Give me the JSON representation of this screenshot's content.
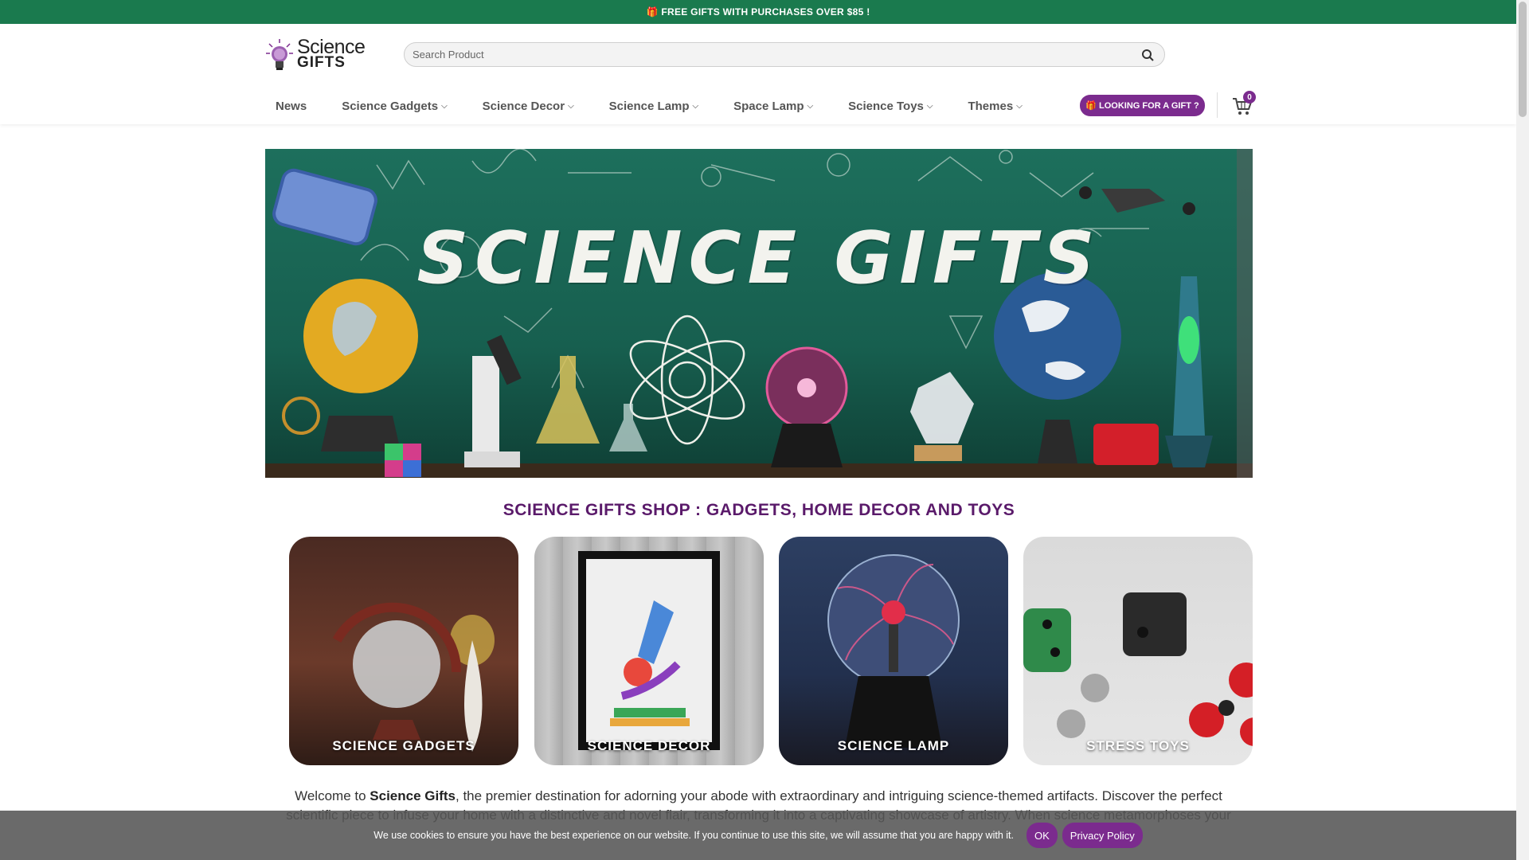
{
  "topbar": {
    "text": "🎁 FREE GIFTS WITH PURCHASES OVER $85 !"
  },
  "logo": {
    "line1": "Science",
    "line2": "GIFTS"
  },
  "search": {
    "placeholder": "Search Product"
  },
  "nav": {
    "items": [
      {
        "label": "News",
        "has_dropdown": false
      },
      {
        "label": "Science Gadgets",
        "has_dropdown": true
      },
      {
        "label": "Science Decor",
        "has_dropdown": true
      },
      {
        "label": "Science Lamp",
        "has_dropdown": true
      },
      {
        "label": "Space Lamp",
        "has_dropdown": true
      },
      {
        "label": "Science Toys",
        "has_dropdown": true
      },
      {
        "label": "Themes",
        "has_dropdown": true
      }
    ],
    "gift_button": "🎁 LOOKING FOR A GIFT ?",
    "cart_count": "0"
  },
  "hero": {
    "title": "SCIENCE GIFTS"
  },
  "section": {
    "title": "SCIENCE GIFTS SHOP : GADGETS, HOME DECOR AND TOYS"
  },
  "categories": [
    {
      "label": "SCIENCE GADGETS"
    },
    {
      "label": "SCIENCE DECOR"
    },
    {
      "label": "SCIENCE LAMP"
    },
    {
      "label": "STRESS TOYS"
    }
  ],
  "intro": {
    "prefix": "Welcome to ",
    "brand": "Science Gifts",
    "text": ", the premier destination for adorning your abode with extraordinary and intriguing science-themed artifacts. Discover the perfect scientific piece to infuse your home with a distinctive and novel flair, transforming it into a captivating showcase of artistry. When science metamorphoses your"
  },
  "cookie": {
    "text": "We use cookies to ensure you have the best experience on our website. If you continue to use this site, we will assume that you are happy with it.",
    "ok_label": "OK",
    "privacy_label": "Privacy Policy"
  },
  "colors": {
    "topbar": "#1a7a4e",
    "accent": "#7b2b8e",
    "title": "#5a1a6a"
  }
}
